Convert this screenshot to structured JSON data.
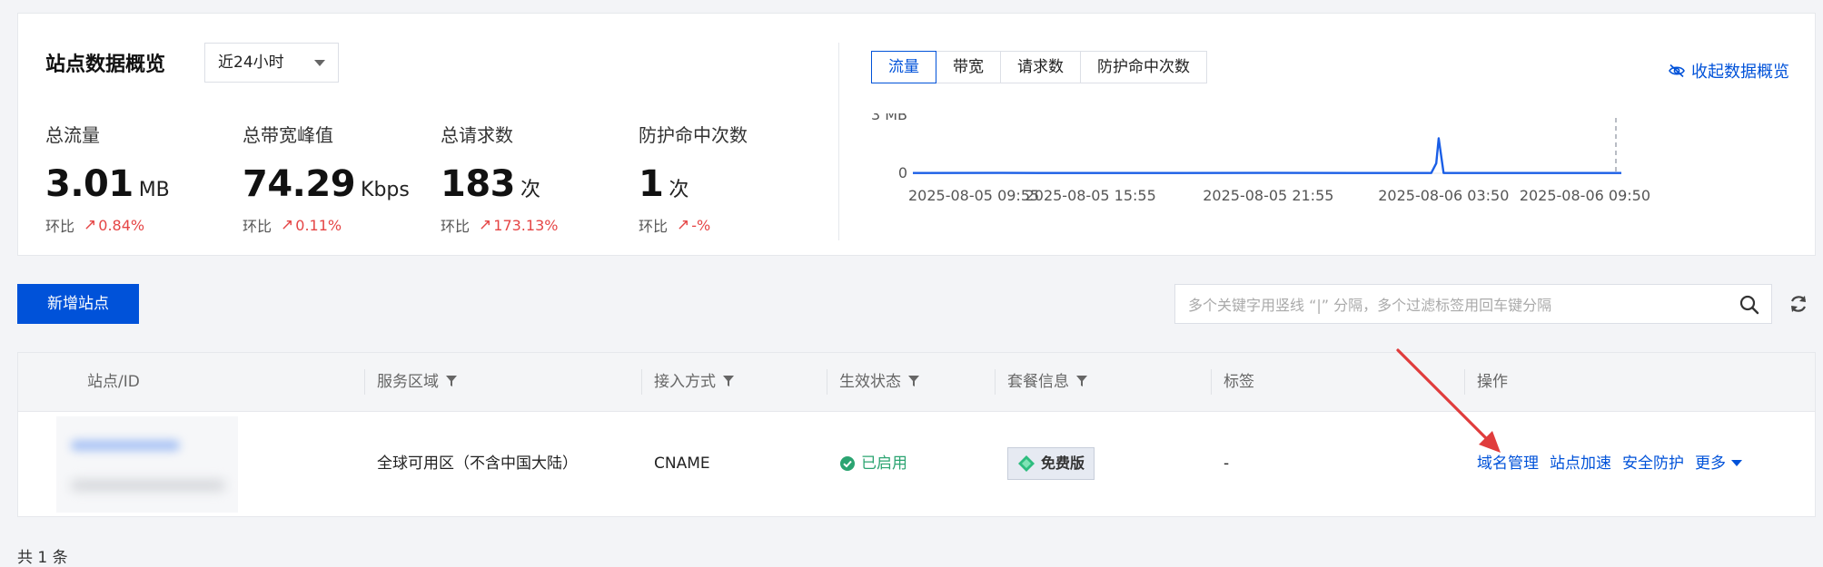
{
  "overview": {
    "title": "站点数据概览",
    "range": "近24小时",
    "metrics": [
      {
        "label": "总流量",
        "value": "3.01",
        "unit": "MB",
        "cmp_label": "环比",
        "cmp": "0.84%"
      },
      {
        "label": "总带宽峰值",
        "value": "74.29",
        "unit": "Kbps",
        "cmp_label": "环比",
        "cmp": "0.11%"
      },
      {
        "label": "总请求数",
        "value": "183",
        "unit": "次",
        "cmp_label": "环比",
        "cmp": "173.13%"
      },
      {
        "label": "防护命中次数",
        "value": "1",
        "unit": "次",
        "cmp_label": "环比",
        "cmp": "-%"
      }
    ],
    "chart_tabs": [
      "流量",
      "带宽",
      "请求数",
      "防护命中次数"
    ],
    "active_tab": 0,
    "collapse_label": "收起数据概览"
  },
  "chart_data": {
    "type": "line",
    "title": "",
    "xlabel": "",
    "ylabel": "",
    "y_ticks": [
      "3 MB",
      "0"
    ],
    "ylim": [
      0,
      3
    ],
    "x_tick_labels": [
      "2025-08-05 09:55",
      "2025-08-05 15:55",
      "2025-08-05 21:55",
      "2025-08-06 03:50",
      "2025-08-06 09:50"
    ],
    "x": [
      "2025-08-05 09:55",
      "2025-08-05 12:55",
      "2025-08-05 15:55",
      "2025-08-05 18:55",
      "2025-08-05 21:55",
      "2025-08-06 00:50",
      "2025-08-06 03:25",
      "2025-08-06 03:35",
      "2025-08-06 03:40",
      "2025-08-06 03:50",
      "2025-08-06 06:50",
      "2025-08-06 09:50"
    ],
    "series": [
      {
        "values": [
          0.02,
          0.03,
          0.02,
          0.02,
          0.03,
          0.02,
          0.02,
          0.8,
          2.82,
          0.02,
          0.02,
          0.02
        ]
      }
    ],
    "color": "#1a5ee6"
  },
  "toolbar": {
    "add_label": "新增站点",
    "search_placeholder": "多个关键字用竖线 “|” 分隔，多个过滤标签用回车键分隔"
  },
  "table": {
    "columns": [
      "站点/ID",
      "服务区域",
      "接入方式",
      "生效状态",
      "套餐信息",
      "标签",
      "操作"
    ],
    "row": {
      "region": "全球可用区（不含中国大陆）",
      "access": "CNAME",
      "status": "已启用",
      "plan": "免费版",
      "tag": "-",
      "ops": [
        "域名管理",
        "站点加速",
        "安全防护"
      ],
      "more": "更多"
    }
  },
  "footer": {
    "total": "共 1 条"
  },
  "colors": {
    "primary": "#0052d9",
    "success": "#2ba471",
    "danger": "#e54545",
    "annotation_arrow": "#e03c3c"
  }
}
